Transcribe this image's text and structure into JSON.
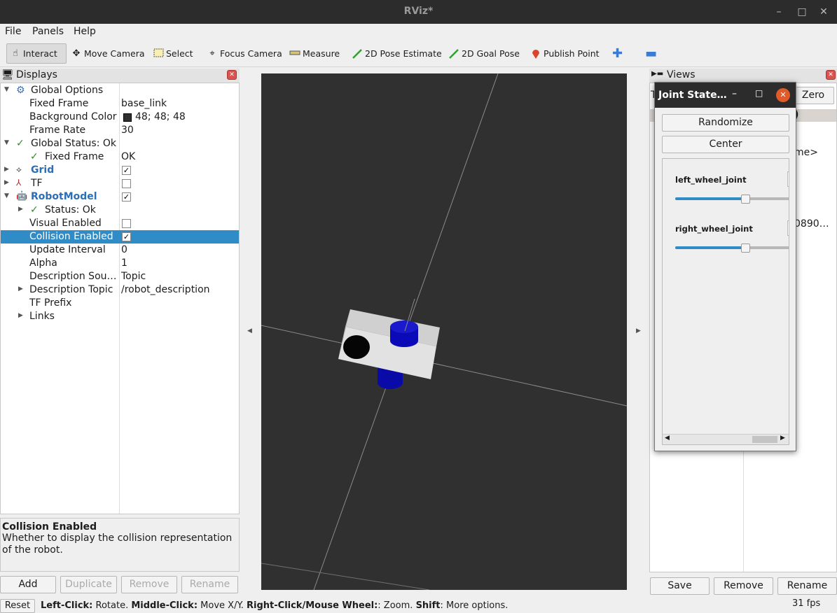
{
  "window": {
    "title": "RViz*"
  },
  "menu": {
    "file": "File",
    "panels": "Panels",
    "help": "Help"
  },
  "toolbar": {
    "interact": "Interact",
    "move_camera": "Move Camera",
    "select": "Select",
    "focus_camera": "Focus Camera",
    "measure": "Measure",
    "pose_estimate": "2D Pose Estimate",
    "goal_pose": "2D Goal Pose",
    "publish_point": "Publish Point"
  },
  "displays": {
    "title": "Displays",
    "global_options": "Global Options",
    "fixed_frame_label": "Fixed Frame",
    "fixed_frame_value": "base_link",
    "bg_color_label": "Background Color",
    "bg_color_value": "48; 48; 48",
    "frame_rate_label": "Frame Rate",
    "frame_rate_value": "30",
    "global_status": "Global Status: Ok",
    "fixed_frame_status_label": "Fixed Frame",
    "fixed_frame_status_value": "OK",
    "grid": "Grid",
    "tf": "TF",
    "robot_model": "RobotModel",
    "status_ok": "Status: Ok",
    "visual_enabled": "Visual Enabled",
    "collision_enabled": "Collision Enabled",
    "update_interval_label": "Update Interval",
    "update_interval_value": "0",
    "alpha_label": "Alpha",
    "alpha_value": "1",
    "desc_source_label": "Description Sou…",
    "desc_source_value": "Topic",
    "desc_topic_label": "Description Topic",
    "desc_topic_value": "/robot_description",
    "tf_prefix": "TF Prefix",
    "links": "Links",
    "bg_color_hex": "#303030"
  },
  "description": {
    "title": "Collision Enabled",
    "text": "Whether to display the collision representation of the robot."
  },
  "display_buttons": {
    "add": "Add",
    "duplicate": "Duplicate",
    "remove": "Remove",
    "rename": "Rename"
  },
  "views": {
    "title": "Views",
    "t_prefix": "T",
    "zero": "Zero",
    "paren": ")",
    "frame": "me>",
    "value": "0890…",
    "save": "Save",
    "remove": "Remove",
    "rename": "Rename"
  },
  "joint_state": {
    "title": "Joint State…",
    "randomize": "Randomize",
    "center": "Center",
    "joints": [
      {
        "name": "left_wheel_joint",
        "position": 0.5
      },
      {
        "name": "right_wheel_joint",
        "position": 0.5
      }
    ]
  },
  "status": {
    "reset": "Reset",
    "hint_l": "Left-Click:",
    "hint_l_t": " Rotate. ",
    "hint_m": "Middle-Click:",
    "hint_m_t": " Move X/Y. ",
    "hint_r": "Right-Click/Mouse Wheel:",
    "hint_r_t": ": Zoom. ",
    "hint_s": "Shift",
    "hint_s_t": ": More options.",
    "fps": "31 fps"
  }
}
